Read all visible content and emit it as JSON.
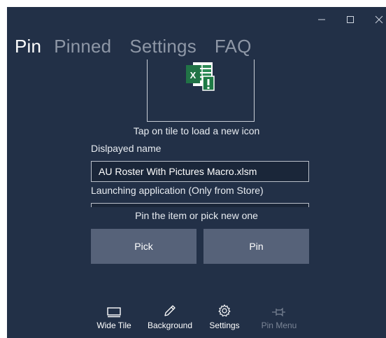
{
  "nav": {
    "tabs": [
      {
        "label": "Pin"
      },
      {
        "label": "Pinned"
      },
      {
        "label": "Settings"
      },
      {
        "label": "FAQ"
      }
    ]
  },
  "tile": {
    "hint": "Tap on tile to load a new icon",
    "icon": "excel-file-warning-icon"
  },
  "form": {
    "displayed_name_label": "Dislpayed name",
    "displayed_name_value": "AU Roster With Pictures Macro.xlsm",
    "launching_app_label": "Launching application (Only from Store)",
    "launching_app_value": ""
  },
  "actions": {
    "prompt": "Pin the item or pick new one",
    "pick_label": "Pick",
    "pin_label": "Pin"
  },
  "appbar": {
    "items": [
      {
        "label": "Wide Tile",
        "icon": "wide-tile-icon"
      },
      {
        "label": "Background",
        "icon": "pencil-icon"
      },
      {
        "label": "Settings",
        "icon": "gear-icon"
      },
      {
        "label": "Pin Menu",
        "icon": "pin-icon"
      }
    ]
  },
  "colors": {
    "background": "#223047",
    "button": "#566279",
    "excel_green": "#217346"
  }
}
